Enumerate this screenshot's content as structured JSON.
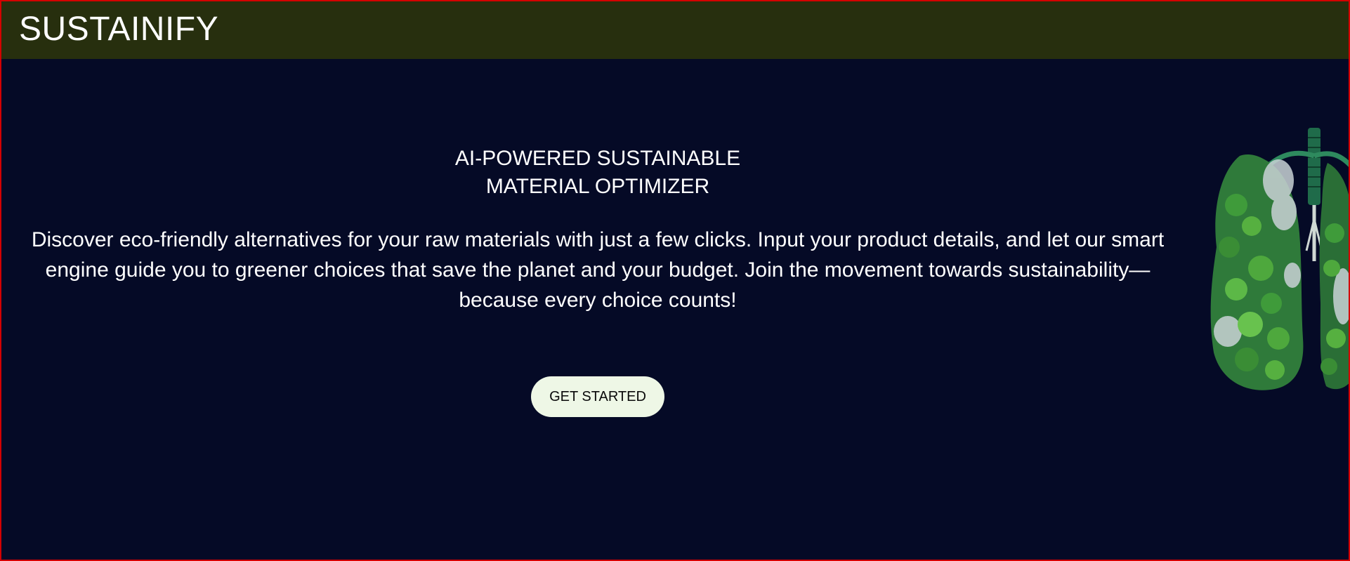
{
  "header": {
    "brand": "SUSTAINIFY"
  },
  "hero": {
    "headline_line1": "AI-POWERED SUSTAINABLE",
    "headline_line2": "MATERIAL OPTIMIZER",
    "description": "Discover eco-friendly alternatives for your raw materials with just a few clicks. Input your product details, and let our smart engine guide you to greener choices that save the planet and your budget. Join the movement towards sustainability—because every choice counts!",
    "cta_label": "GET STARTED"
  },
  "illustration": {
    "icon": "tree-lungs-illustration"
  },
  "colors": {
    "background": "#050a26",
    "header_bg": "#272f0e",
    "frame_border": "#d40000",
    "button_bg": "#eef7e6",
    "text": "#ffffff"
  }
}
